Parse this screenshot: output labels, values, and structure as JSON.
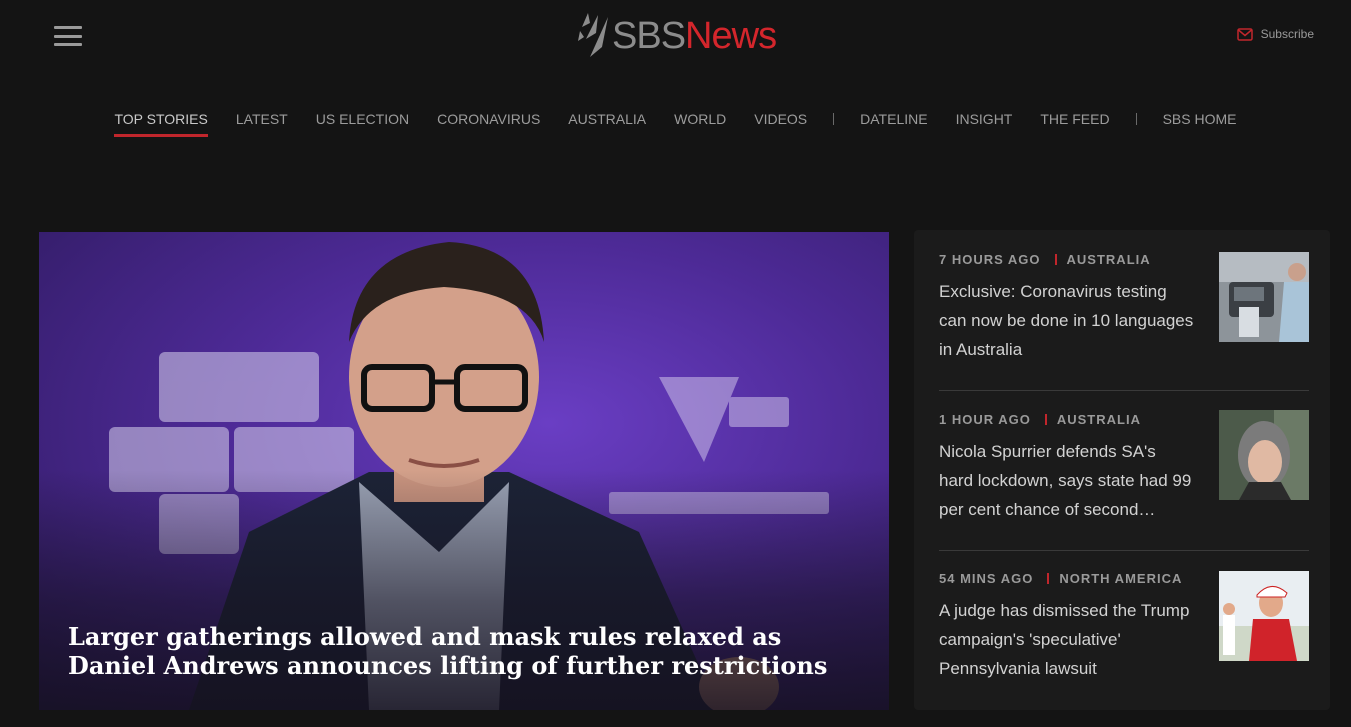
{
  "header": {
    "logo_sbs": "SBS",
    "logo_news": "News",
    "subscribe_label": "Subscribe"
  },
  "nav": {
    "items": [
      "TOP STORIES",
      "LATEST",
      "US ELECTION",
      "CORONAVIRUS",
      "AUSTRALIA",
      "WORLD",
      "VIDEOS",
      "DATELINE",
      "INSIGHT",
      "THE FEED",
      "SBS HOME"
    ],
    "active": "TOP STORIES"
  },
  "hero": {
    "title": "Larger gatherings allowed and mask rules relaxed as Daniel Andrews announces lifting of further restrictions"
  },
  "sidebar": {
    "stories": [
      {
        "time": "7 HOURS AGO",
        "category": "AUSTRALIA",
        "title": "Exclusive: Coronavirus testing can now be done in 10 languages in Australia"
      },
      {
        "time": "1 HOUR AGO",
        "category": "AUSTRALIA",
        "title": "Nicola Spurrier defends SA's hard lockdown, says state had 99 per cent chance of second…"
      },
      {
        "time": "54 MINS AGO",
        "category": "NORTH AMERICA",
        "title": "A judge has dismissed the Trump campaign's 'speculative' Pennsylvania lawsuit"
      }
    ]
  },
  "colors": {
    "background": "#141414",
    "accent": "#c1262c",
    "sidebar_bg": "#1b1b1b",
    "hero_purple": "#5a32b0"
  },
  "icons": {
    "menu": "hamburger-icon",
    "subscribe": "mail-icon",
    "logo": "sbs-logo-icon"
  }
}
